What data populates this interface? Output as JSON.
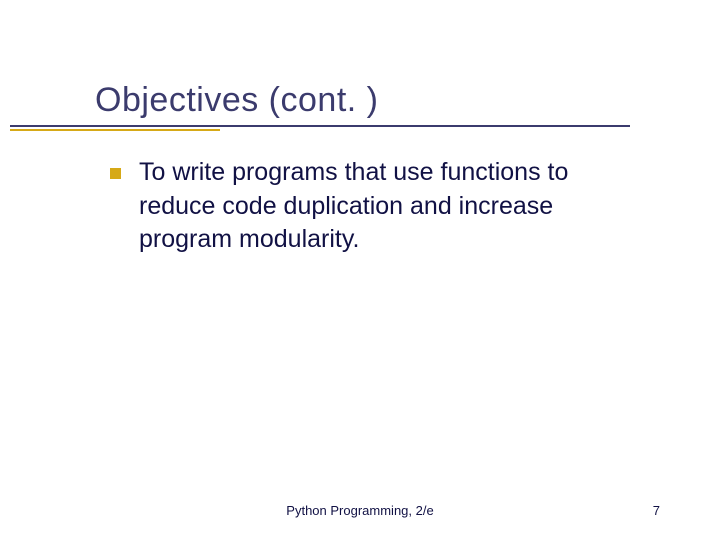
{
  "slide": {
    "title": "Objectives (cont. )",
    "bullet": {
      "text": "To write programs that use functions to reduce code duplication and increase program modularity."
    }
  },
  "footer": {
    "text": "Python Programming, 2/e",
    "page_number": "7"
  }
}
